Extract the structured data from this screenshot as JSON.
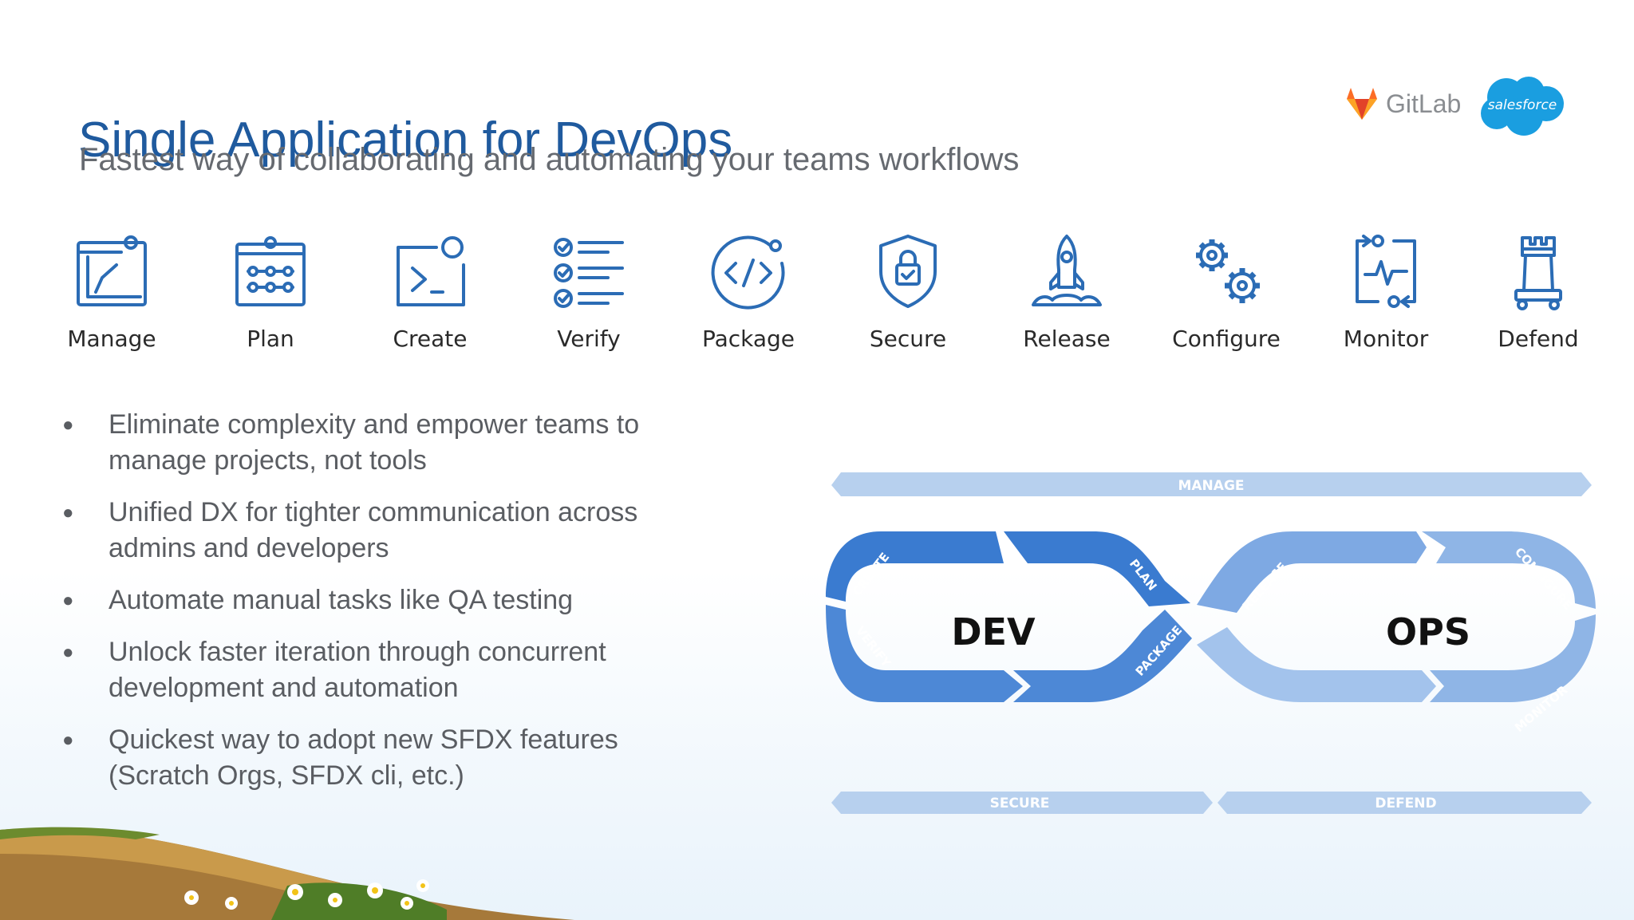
{
  "title": "Single Application for DevOps",
  "subtitle": "Fastest way of collaborating and automating your teams workflows",
  "logos": {
    "gitlab": "GitLab",
    "salesforce": "salesforce"
  },
  "stages": [
    {
      "label": "Manage",
      "icon": "manage-icon"
    },
    {
      "label": "Plan",
      "icon": "plan-icon"
    },
    {
      "label": "Create",
      "icon": "create-icon"
    },
    {
      "label": "Verify",
      "icon": "verify-icon"
    },
    {
      "label": "Package",
      "icon": "package-icon"
    },
    {
      "label": "Secure",
      "icon": "secure-icon"
    },
    {
      "label": "Release",
      "icon": "release-icon"
    },
    {
      "label": "Configure",
      "icon": "configure-icon"
    },
    {
      "label": "Monitor",
      "icon": "monitor-icon"
    },
    {
      "label": "Defend",
      "icon": "defend-icon"
    }
  ],
  "bullets": [
    "Eliminate complexity and empower teams to manage projects, not tools",
    "Unified DX for tighter communication across admins and developers",
    "Automate manual tasks like QA testing",
    "Unlock faster iteration through concurrent development and automation",
    "Quickest way to adopt new SFDX features (Scratch Orgs, SFDX cli, etc.)"
  ],
  "diagram": {
    "manage": "MANAGE",
    "secure": "SECURE",
    "defend": "DEFEND",
    "dev": "DEV",
    "ops": "OPS",
    "arrows": {
      "create": "CREATE",
      "plan": "PLAN",
      "verify": "VERIFY",
      "package": "PACKAGE",
      "release": "RELEASE",
      "configure": "CONFIGURE",
      "monitor": "MONITOR"
    }
  },
  "colors": {
    "title": "#1f5a9e",
    "icon": "#2b6cb5",
    "dev_blue": "#3a7bd0",
    "ops_blue": "#8fb5e6",
    "bar": "#b7d0ee"
  }
}
